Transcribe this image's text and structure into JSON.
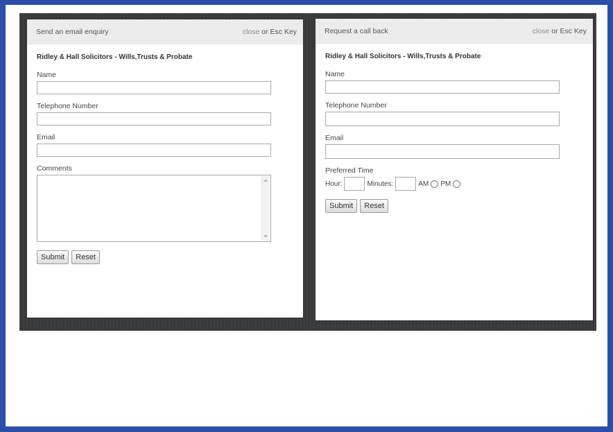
{
  "email_modal": {
    "title": "Send an email enquiry",
    "close_link": "close",
    "close_suffix": " or Esc Key",
    "firm_name": "Ridley & Hall Solicitors - Wills,Trusts & Probate",
    "fields": {
      "name_label": "Name",
      "name_value": "",
      "phone_label": "Telephone Number",
      "phone_value": "",
      "email_label": "Email",
      "email_value": "",
      "comments_label": "Comments",
      "comments_value": ""
    },
    "submit_label": "Submit",
    "reset_label": "Reset"
  },
  "callback_modal": {
    "title": "Request a call back",
    "close_link": "close",
    "close_suffix": " or Esc Key",
    "firm_name": "Ridley & Hall Solicitors - Wills,Trusts & Probate",
    "fields": {
      "name_label": "Name",
      "name_value": "",
      "phone_label": "Telephone Number",
      "phone_value": "",
      "email_label": "Email",
      "email_value": ""
    },
    "preferred_time": {
      "label": "Preferred Time",
      "hour_label": "Hour:",
      "hour_value": "",
      "minutes_label": "Minutes:",
      "minutes_value": "",
      "am_label": "AM",
      "pm_label": "PM"
    },
    "submit_label": "Submit",
    "reset_label": "Reset"
  },
  "colors": {
    "frame_border": "#2c4ea8",
    "overlay": "#3a3b3d",
    "modal_header": "#ececec"
  }
}
